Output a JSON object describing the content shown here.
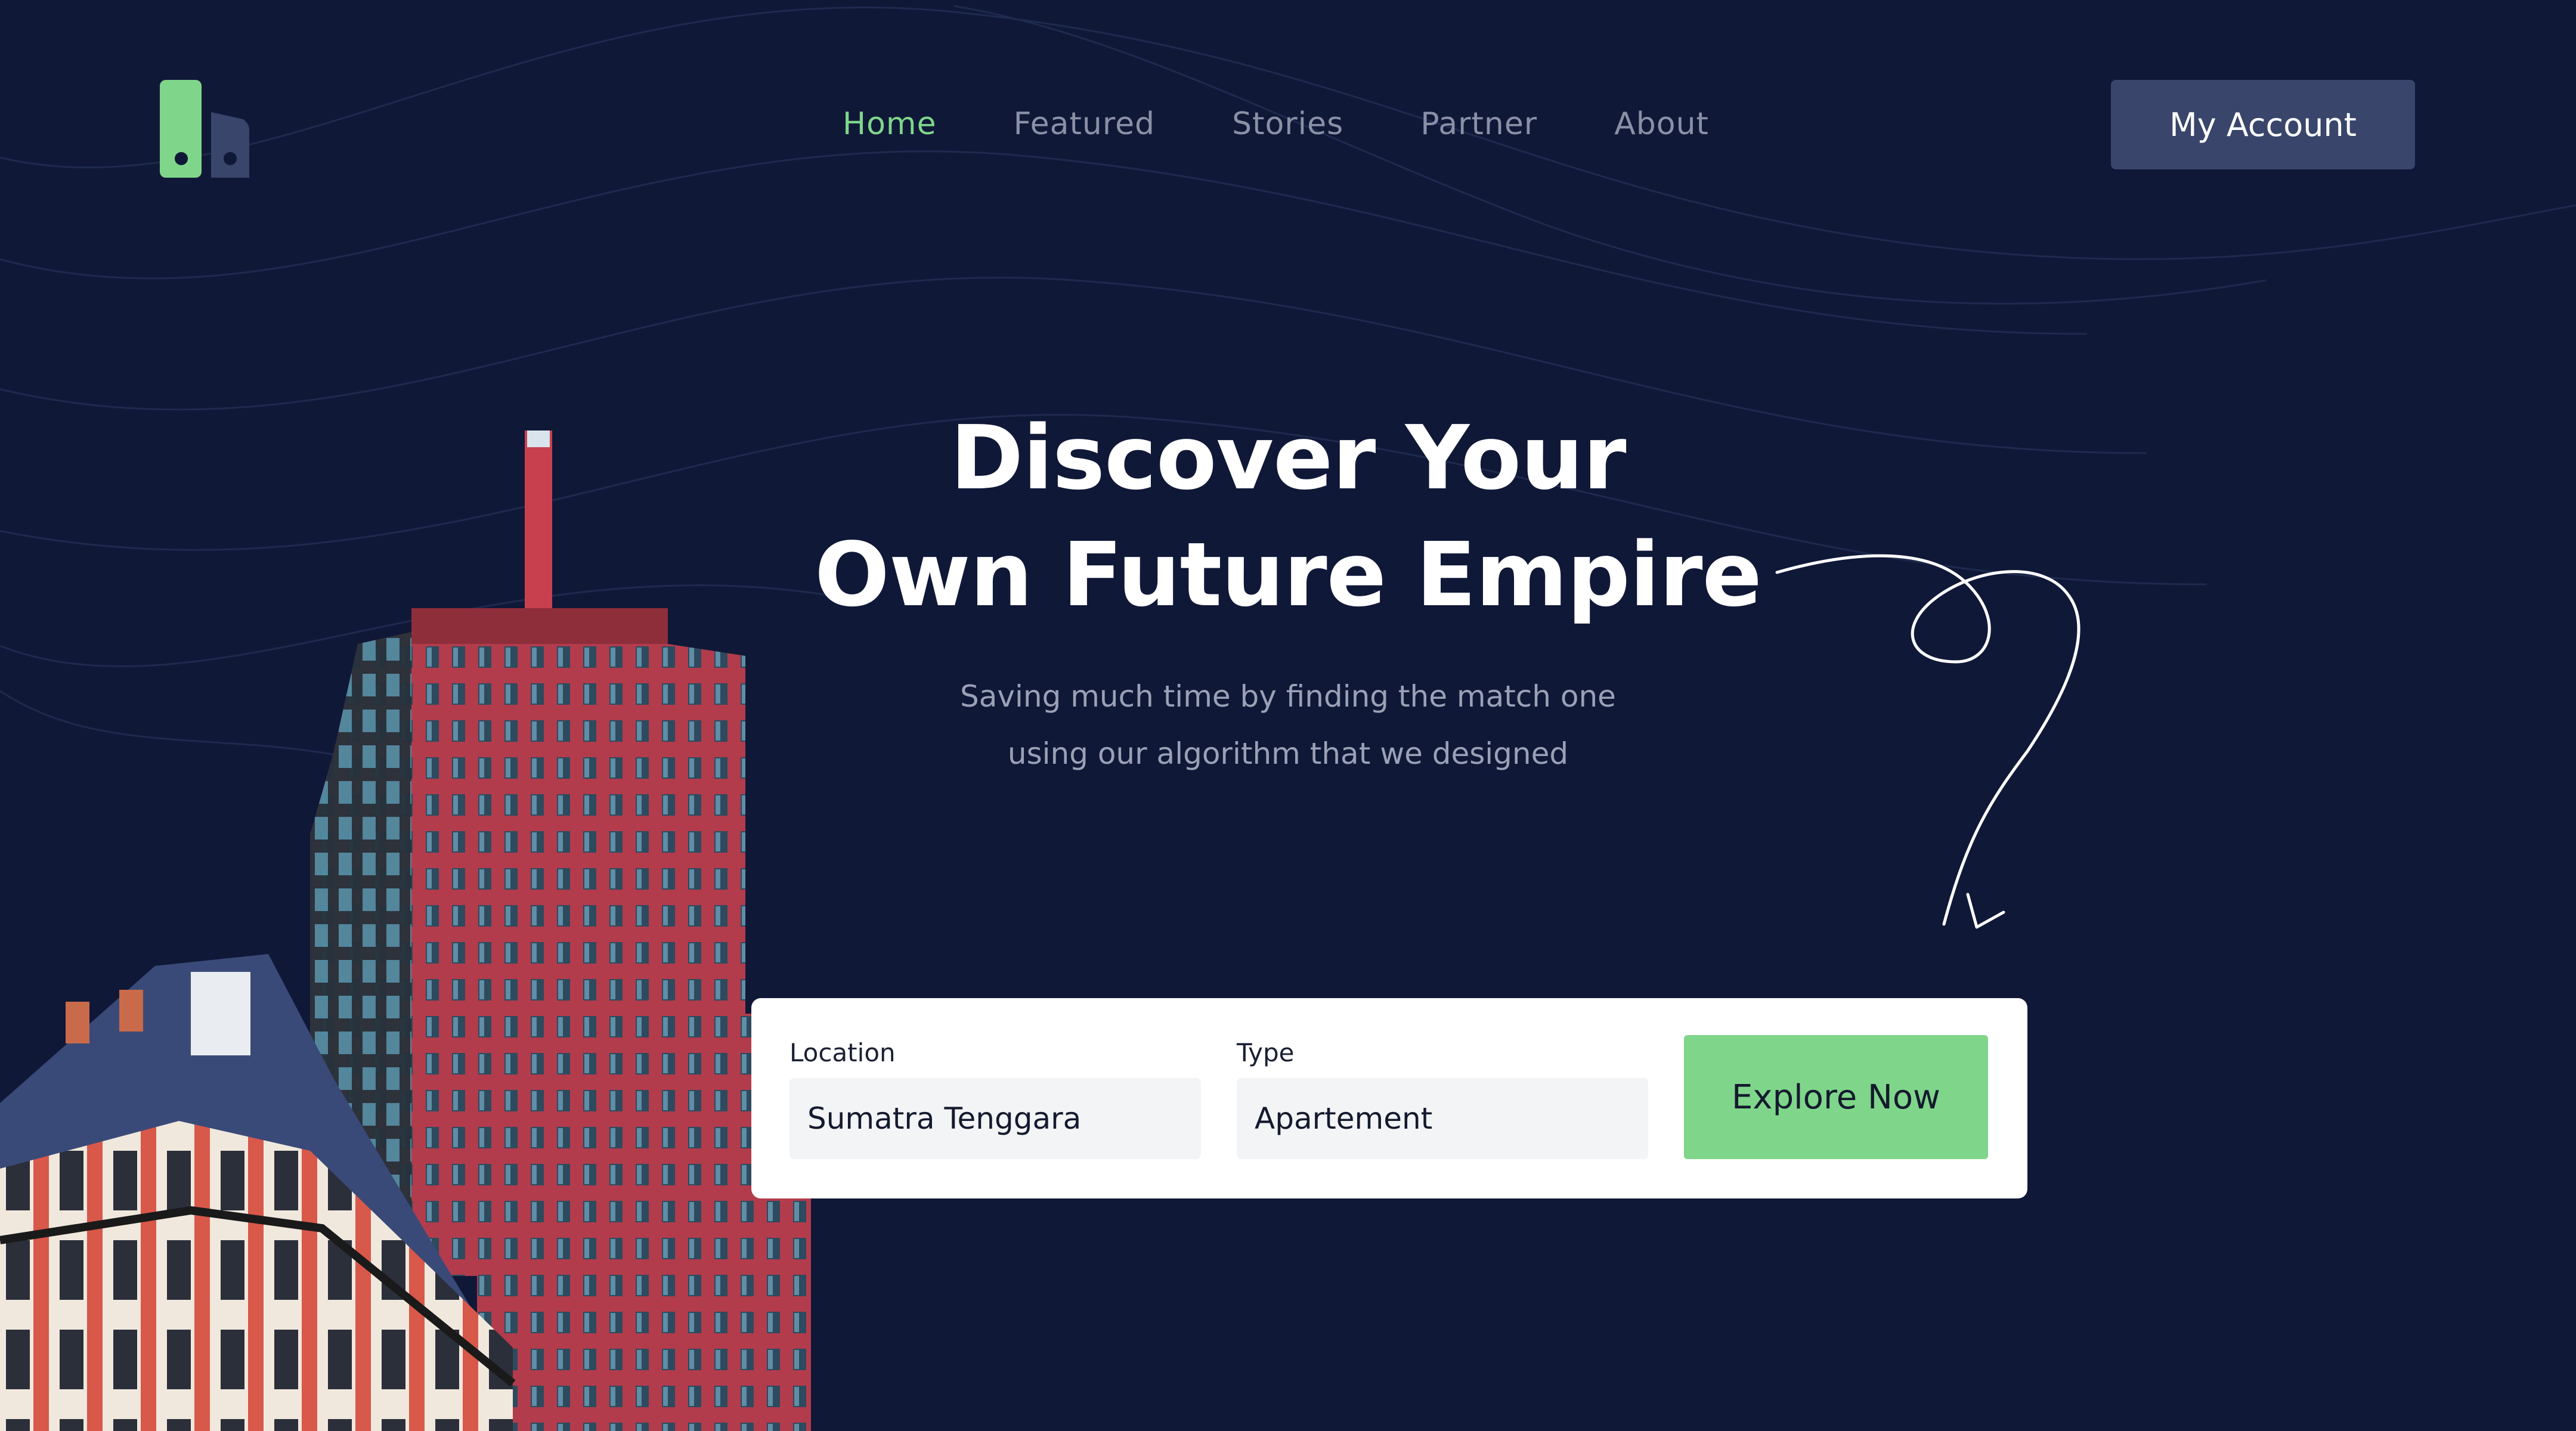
{
  "brand": {
    "icon": "logo-icon",
    "colors": {
      "primary": "#7fd68a",
      "secondary": "#39456a"
    }
  },
  "nav": {
    "items": [
      {
        "label": "Home",
        "active": true
      },
      {
        "label": "Featured",
        "active": false
      },
      {
        "label": "Stories",
        "active": false
      },
      {
        "label": "Partner",
        "active": false
      },
      {
        "label": "About",
        "active": false
      }
    ],
    "account_label": "My Account"
  },
  "hero": {
    "title_line1": "Discover Your",
    "title_line2": "Own Future Empire",
    "subtitle_line1": "Saving much time by finding the match one",
    "subtitle_line2": "using our algorithm that we designed"
  },
  "search": {
    "location_label": "Location",
    "location_value": "Sumatra Tenggara",
    "type_label": "Type",
    "type_value": "Apartement",
    "cta_label": "Explore Now"
  },
  "colors": {
    "background": "#101838",
    "accent": "#7fd68a",
    "button": "#39456a",
    "card": "#ffffff",
    "field": "#f3f4f6"
  }
}
